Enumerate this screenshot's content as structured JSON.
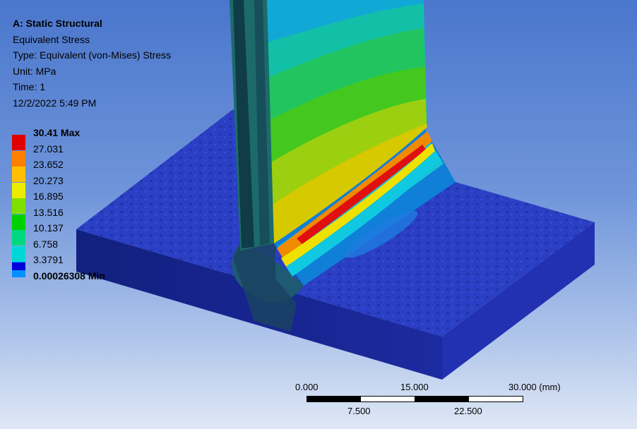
{
  "header": {
    "analysis": "A: Static Structural",
    "result": "Equivalent Stress",
    "type": "Type: Equivalent (von-Mises) Stress",
    "unit": "Unit: MPa",
    "time": "Time: 1",
    "timestamp": "12/2/2022 5:49 PM"
  },
  "legend": [
    {
      "label": "30.41 Max",
      "color": "#e00000",
      "bold": true
    },
    {
      "label": "27.031",
      "color": "#ff7f00",
      "bold": false
    },
    {
      "label": "23.652",
      "color": "#ffbf00",
      "bold": false
    },
    {
      "label": "20.273",
      "color": "#ecec00",
      "bold": false
    },
    {
      "label": "16.895",
      "color": "#7fdf00",
      "bold": false
    },
    {
      "label": "13.516",
      "color": "#00d000",
      "bold": false
    },
    {
      "label": "10.137",
      "color": "#00d880",
      "bold": false
    },
    {
      "label": "6.758",
      "color": "#00d8d8",
      "bold": false
    },
    {
      "label": "3.3791",
      "color": "#0090ff",
      "bold": false
    },
    {
      "label": "0.00026308 Min",
      "color": "#0000d8",
      "bold": true
    }
  ],
  "scale": {
    "top_labels": [
      "0.000",
      "15.000",
      "30.000 (mm)"
    ],
    "bottom_labels": [
      "7.500",
      "22.500"
    ]
  },
  "colors": {
    "background_top": "#4a76cc",
    "background_bottom": "#dfe8f6",
    "base_top": "#2a3fc4",
    "base_front": "#1b2a9a",
    "base_side": "#2230b2"
  }
}
